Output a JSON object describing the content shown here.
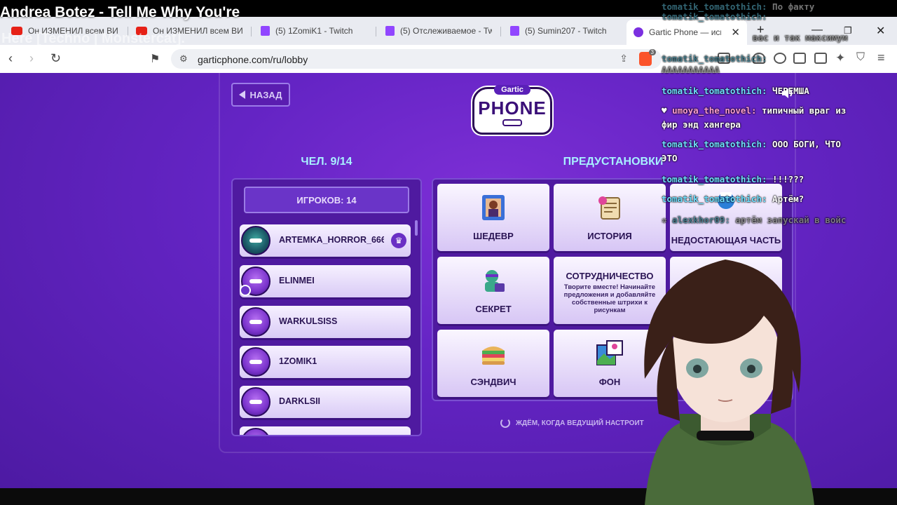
{
  "overlay": {
    "song_line1": "Andrea Botez - Tell Me Why You're",
    "song_line2": "Here [Techno | Monstercat]."
  },
  "browser": {
    "tabs": [
      {
        "label": "Он ИЗМЕНИЛ всем ВИ",
        "icon": "youtube-icon"
      },
      {
        "label": "Он ИЗМЕНИЛ всем ВИ",
        "icon": "youtube-icon"
      },
      {
        "label": "(5) 1ZomiK1 - Twitch",
        "icon": "twitch-icon"
      },
      {
        "label": "(5) Отслеживаемое - Tw",
        "icon": "twitch-icon"
      },
      {
        "label": "(5) Sumin207 - Twitch",
        "icon": "twitch-icon"
      },
      {
        "label": "Gartic Phone — исп",
        "icon": "gartic-icon"
      }
    ],
    "new_tab": "+",
    "url": "garticphone.com/ru/lobby",
    "brave_badge": "3"
  },
  "lobby": {
    "back_label": "НАЗАД",
    "logo_small": "Gartic",
    "logo_big": "PHONE",
    "players_title": "ЧЕЛ. 9/14",
    "presets_title": "ПРЕДУСТАНОВКИ",
    "players_count": "ИГРОКОВ: 14",
    "players": [
      {
        "name": "ARTEMKA_HORROR_666",
        "host": true
      },
      {
        "name": "ELINMEI"
      },
      {
        "name": "WARKULSISS"
      },
      {
        "name": "1ZOMIK1"
      },
      {
        "name": "DARKLSII"
      }
    ],
    "presets": [
      {
        "label": "ШЕДЕВР",
        "icon": "masterpiece-icon"
      },
      {
        "label": "ИСТОРИЯ",
        "icon": "scroll-icon"
      },
      {
        "label": "НЕДОСТАЮЩАЯ ЧАСТЬ",
        "icon": "missing-piece-icon"
      },
      {
        "label": "СЕКРЕТ",
        "icon": "secret-icon"
      },
      {
        "label": "СОТРУДНИЧЕСТВО",
        "description": "Творите вместе! Начинайте предложения и добавляйте собственные штрихи к рисункам"
      },
      {
        "label": "СЭНДВИЧ",
        "icon": "sandwich-icon"
      },
      {
        "label": "ФОН",
        "icon": "background-icon"
      }
    ],
    "waiting": "ЖДЁМ, КОГДА ВЕДУЩИЙ НАСТРОИТ"
  },
  "chat": [
    {
      "user": "tomatik_tomatothich:",
      "text": "По факту",
      "dim": true
    },
    {
      "user": "",
      "text": "вас и так максимум",
      "dim": true
    },
    {
      "user": "tomatik_tomatothich:",
      "text": "",
      "dim": true
    },
    {
      "user": "",
      "text": "ААААААААААА",
      "dim": true
    },
    {
      "user": "tomatik_tomatothich:",
      "text": "ЧЕРЕМША"
    },
    {
      "user": "umoya_the_novel:",
      "text": "типичный враг из",
      "pink": true
    },
    {
      "user": "",
      "text": "фир энд хангера"
    },
    {
      "user": "tomatik_tomatothich:",
      "text": "ООО БОГИ, ЧТО"
    },
    {
      "user": "",
      "text": "ЭТО"
    },
    {
      "user": "tomatik_tomatothich:",
      "text": "!!!???"
    },
    {
      "user": "tomatik_tomatothich:",
      "text": "Артём?"
    },
    {
      "user": "alexkhor09:",
      "text": "артём запускай в войс",
      "dim": true
    }
  ]
}
